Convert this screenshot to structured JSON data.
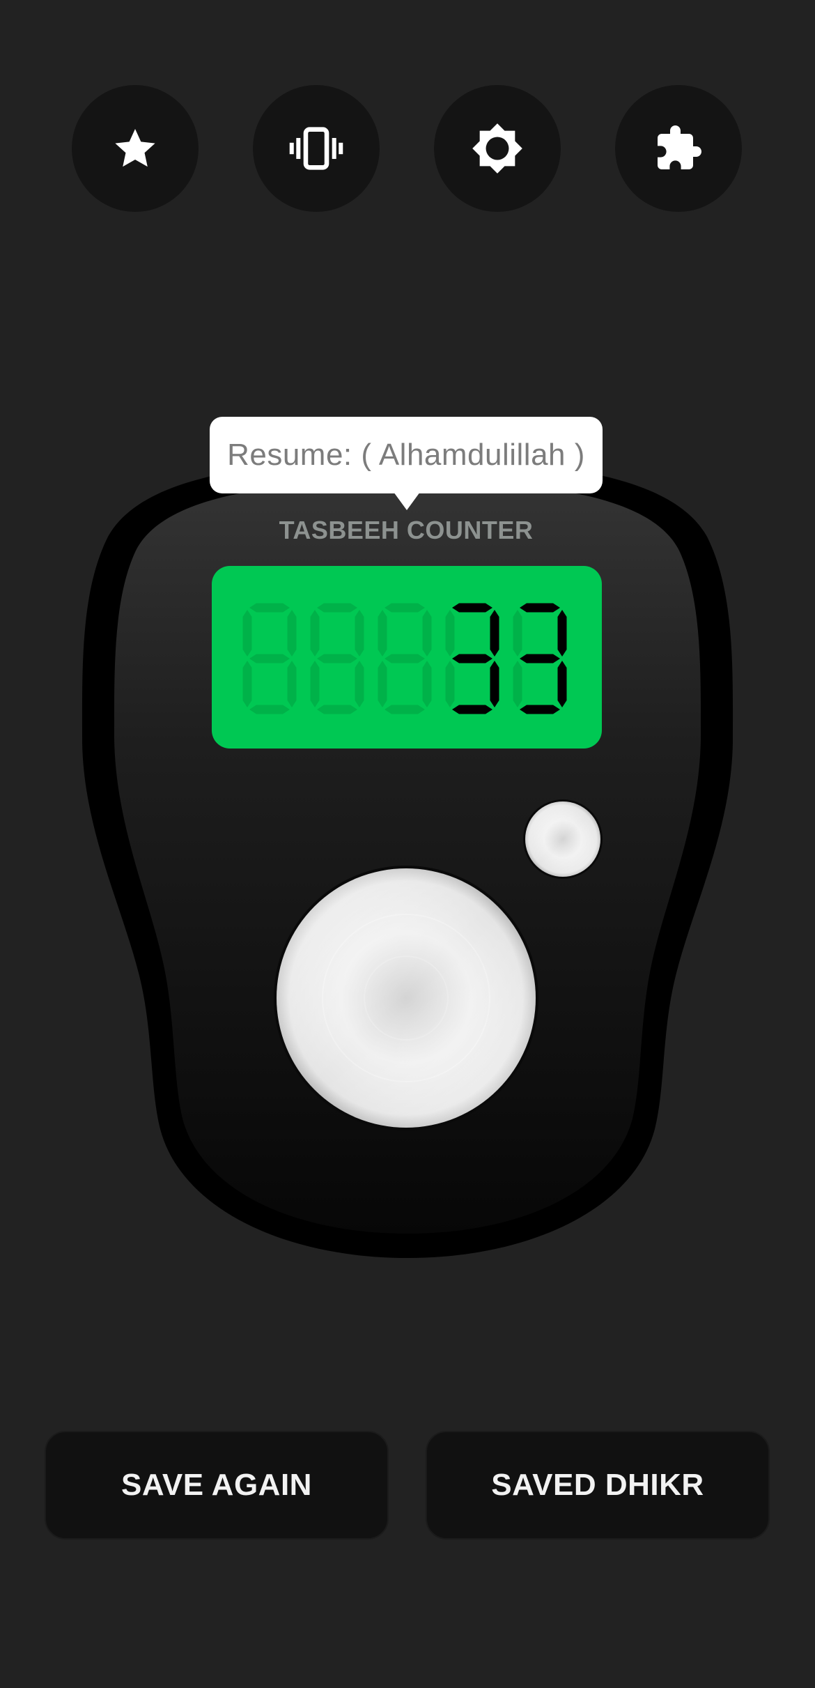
{
  "toolbar": {
    "buttons": [
      {
        "icon": "star-icon",
        "name": "favorites"
      },
      {
        "icon": "vibration-icon",
        "name": "vibration"
      },
      {
        "icon": "brightness-icon",
        "name": "theme"
      },
      {
        "icon": "puzzle-icon",
        "name": "extensions"
      }
    ]
  },
  "tooltip": {
    "text": "Resume: ( Alhamdulillah )"
  },
  "counter": {
    "label": "TASBEEH COUNTER",
    "count": "00033",
    "display_color": "#00c853",
    "digit_color": "#000000"
  },
  "actions": {
    "save_again": "SAVE AGAIN",
    "saved_dhikr": "SAVED DHIKR"
  }
}
